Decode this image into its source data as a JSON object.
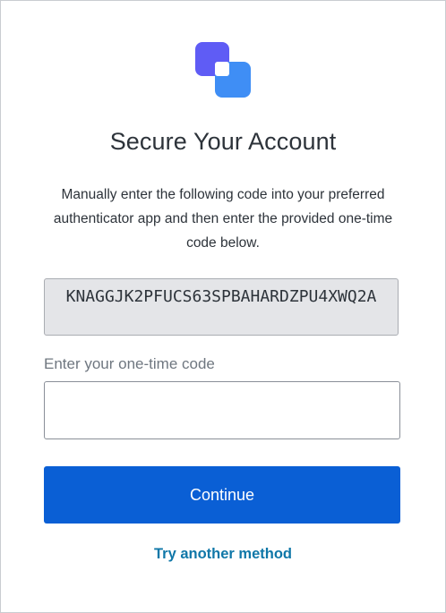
{
  "colors": {
    "primary_button": "#0a5fd5",
    "link": "#0f77a8",
    "logo_back": "#5f5cf5",
    "logo_front": "#3f8ef5",
    "code_background": "#e4e5e8"
  },
  "logo": {
    "icon": "overlapping-squares-logo"
  },
  "heading": {
    "title": "Secure Your Account"
  },
  "instructions": {
    "text": "Manually enter the following code into your preferred authenticator app and then enter the provided one-time code below."
  },
  "secret": {
    "code": "KNAGGJK2PFUCS63SPBAHARDZPU4XWQ2A"
  },
  "otp_field": {
    "label": "Enter your one-time code",
    "value": ""
  },
  "actions": {
    "continue_label": "Continue",
    "alternate_label": "Try another method"
  }
}
